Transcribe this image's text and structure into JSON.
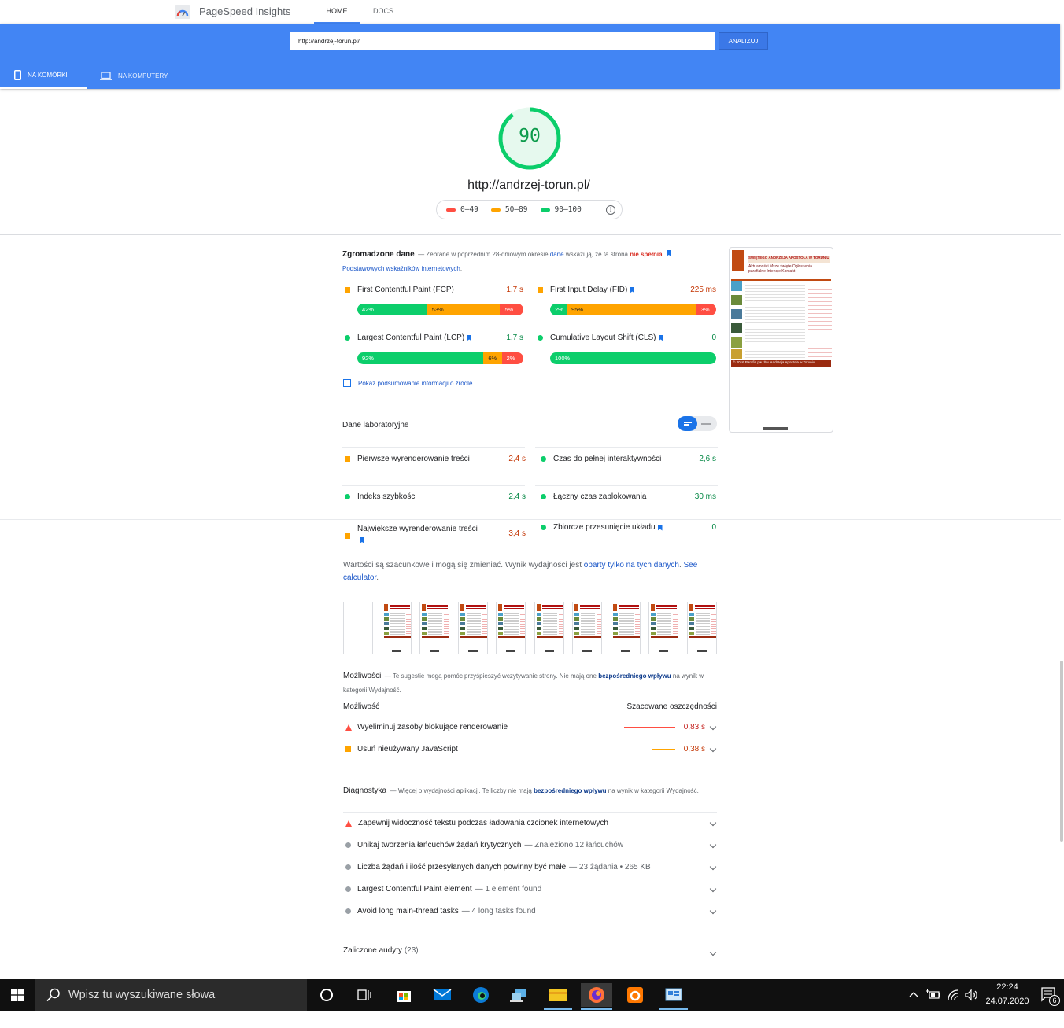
{
  "header": {
    "app_title": "PageSpeed Insights",
    "nav": [
      "HOME",
      "DOCS"
    ]
  },
  "search": {
    "url_value": "http://andrzej-torun.pl/",
    "analyze_label": "ANALIZUJ"
  },
  "device_tabs": {
    "mobile": "NA KOMÓRKI",
    "desktop": "NA KOMPUTERY"
  },
  "score": {
    "value": "90",
    "fraction": 0.9,
    "url": "http://andrzej-torun.pl/",
    "legend": [
      "0–49",
      "50–89",
      "90–100"
    ],
    "colors": {
      "fail": "#ff4e42",
      "average": "#ffa400",
      "pass": "#0cce6b"
    }
  },
  "field": {
    "title": "Zgromadzone dane",
    "desc_pre": "— Zebrane w poprzednim 28-dniowym okresie",
    "desc_link1": "dane",
    "desc_mid": "wskazują, że ta strona",
    "desc_red": "nie spełnia",
    "desc_link2": "Podstawowych wskaźników internetowych",
    "desc_end": ".",
    "metrics": [
      {
        "name": "First Contentful Paint (FCP)",
        "value": "1,7 s",
        "dist": [
          "42%",
          "53%",
          "5%"
        ]
      },
      {
        "name": "First Input Delay (FID)",
        "value": "225 ms",
        "dist": [
          "2%",
          "95%",
          "3%"
        ]
      },
      {
        "name": "Largest Contentful Paint (LCP)",
        "value": "1,7 s",
        "dist": [
          "92%",
          "6%",
          "2%"
        ]
      },
      {
        "name": "Cumulative Layout Shift (CLS)",
        "value": "0",
        "dist": [
          "100%"
        ]
      }
    ],
    "show_source": "Pokaż podsumowanie informacji o źródle"
  },
  "lab": {
    "title": "Dane laboratoryjne",
    "metrics": [
      {
        "name": "Pierwsze wyrenderowanie treści",
        "value": "2,4 s"
      },
      {
        "name": "Czas do pełnej interaktywności",
        "value": "2,6 s"
      },
      {
        "name": "Indeks szybkości",
        "value": "2,4 s"
      },
      {
        "name": "Łączny czas zablokowania",
        "value": "30 ms"
      },
      {
        "name": "Największe wyrenderowanie treści",
        "value": "3,4 s"
      },
      {
        "name": "Zbiorcze przesunięcie układu",
        "value": "0"
      }
    ],
    "note_pre": "Wartości są szacunkowe i mogą się zmieniać. Wynik wydajności jest",
    "note_link1": "oparty tylko na tych danych",
    "note_link2": "See calculator",
    "note_end": "."
  },
  "thumbnail": {
    "header": "ŚWIĘTEGO ANDRZEJA APOSTOŁA W TORUNIU",
    "menu": [
      "Aktualności",
      "Msze święte",
      "Ogłoszenia parafialne",
      "Intencje",
      "Kontakt"
    ],
    "footer": "© 2016 Parafia pw. Św. Andrzeja Apostoła w Toruniu"
  },
  "opportunities": {
    "title": "Możliwości",
    "desc_pre": "— Te sugestie mogą pomóc przyśpieszyć wczytywanie strony. Nie mają one",
    "desc_link": "bezpośredniego wpływu",
    "desc_end": "na wynik w kategorii Wydajność.",
    "col_left": "Możliwość",
    "col_right": "Szacowane oszczędności",
    "items": [
      {
        "name": "Wyeliminuj zasoby blokujące renderowanie",
        "value": "0,83 s",
        "bar_fraction": 0.83
      },
      {
        "name": "Usuń nieużywany JavaScript",
        "value": "0,38 s",
        "bar_fraction": 0.38
      }
    ]
  },
  "diagnostics": {
    "title": "Diagnostyka",
    "desc_pre": "— Więcej o wydajności aplikacji. Te liczby nie mają",
    "desc_link": "bezpośredniego wpływu",
    "desc_end": "na wynik w kategorii Wydajność.",
    "items": [
      {
        "name": "Zapewnij widoczność tekstu podczas ładowania czcionek internetowych",
        "sub": ""
      },
      {
        "name": "Unikaj tworzenia łańcuchów żądań krytycznych",
        "sub": "— Znaleziono 12 łańcuchów"
      },
      {
        "name": "Liczba żądań i ilość przesyłanych danych powinny być małe",
        "sub": "— 23 żądania • 265 KB"
      },
      {
        "name": "Largest Contentful Paint element",
        "sub": "— 1 element found"
      },
      {
        "name": "Avoid long main-thread tasks",
        "sub": "— 4 long tasks found"
      }
    ]
  },
  "passed": {
    "title": "Zaliczone audyty",
    "count": "(23)"
  },
  "taskbar": {
    "search_placeholder": "Wpisz tu wyszukiwane słowa",
    "time": "22:24",
    "date": "24.07.2020",
    "notif_count": "6"
  }
}
